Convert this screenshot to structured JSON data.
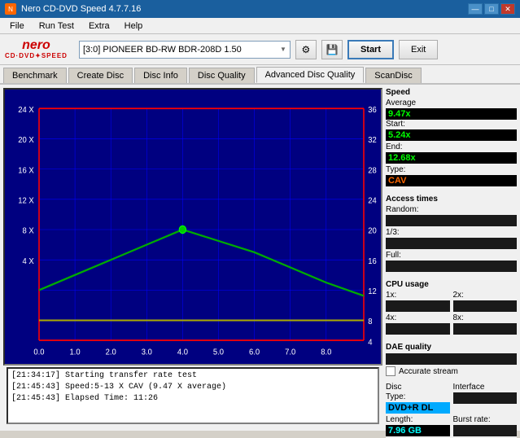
{
  "titleBar": {
    "title": "Nero CD-DVD Speed 4.7.7.16",
    "controls": [
      "minimize",
      "maximize",
      "close"
    ]
  },
  "menuBar": {
    "items": [
      "File",
      "Run Test",
      "Extra",
      "Help"
    ]
  },
  "toolbar": {
    "drive": "[3:0]  PIONEER BD-RW  BDR-208D 1.50",
    "startLabel": "Start",
    "exitLabel": "Exit"
  },
  "tabs": [
    {
      "label": "Benchmark",
      "active": false
    },
    {
      "label": "Create Disc",
      "active": false
    },
    {
      "label": "Disc Info",
      "active": false
    },
    {
      "label": "Disc Quality",
      "active": false
    },
    {
      "label": "Advanced Disc Quality",
      "active": true
    },
    {
      "label": "ScanDisc",
      "active": false
    }
  ],
  "speed": {
    "title": "Speed",
    "averageLabel": "Average",
    "averageValue": "9.47x",
    "startLabel": "Start:",
    "startValue": "5.24x",
    "endLabel": "End:",
    "endValue": "12.68x",
    "typeLabel": "Type:",
    "typeValue": "CAV"
  },
  "accessTimes": {
    "title": "Access times",
    "randomLabel": "Random:",
    "randomValue": "",
    "thirdLabel": "1/3:",
    "thirdValue": "",
    "fullLabel": "Full:",
    "fullValue": ""
  },
  "cpuUsage": {
    "title": "CPU usage",
    "x1Label": "1x:",
    "x1Value": "",
    "x2Label": "2x:",
    "x2Value": "",
    "x4Label": "4x:",
    "x4Value": "",
    "x8Label": "8x:",
    "x8Value": ""
  },
  "daeQuality": {
    "title": "DAE quality",
    "value": "",
    "accurateStreamLabel": "Accurate stream",
    "accurateStreamChecked": false
  },
  "discInfo": {
    "typeTitle": "Disc",
    "typeLabel": "Type:",
    "typeValue": "DVD+R DL",
    "lengthLabel": "Length:",
    "lengthValue": "7.96 GB",
    "interface": "Interface",
    "burstRate": "Burst rate:"
  },
  "log": {
    "lines": [
      "[21:34:17]  Starting transfer rate test",
      "[21:45:43]  Speed:5-13 X CAV (9.47 X average)",
      "[21:45:43]  Elapsed Time: 11:26"
    ]
  },
  "chart": {
    "xAxisMin": "0.0",
    "xAxisMax": "8.0",
    "xAxisLabels": [
      "0.0",
      "1.0",
      "2.0",
      "3.0",
      "4.0",
      "5.0",
      "6.0",
      "7.0",
      "8.0"
    ],
    "yAxisRight1Labels": [
      "36",
      "32",
      "28",
      "24",
      "20",
      "16",
      "12",
      "8",
      "4"
    ],
    "yAxisLeft1Labels": [
      "24 X",
      "20 X",
      "16 X",
      "12 X",
      "8 X",
      "4 X"
    ],
    "accentColor": "#ff0000",
    "gridColor": "#0000ff"
  }
}
